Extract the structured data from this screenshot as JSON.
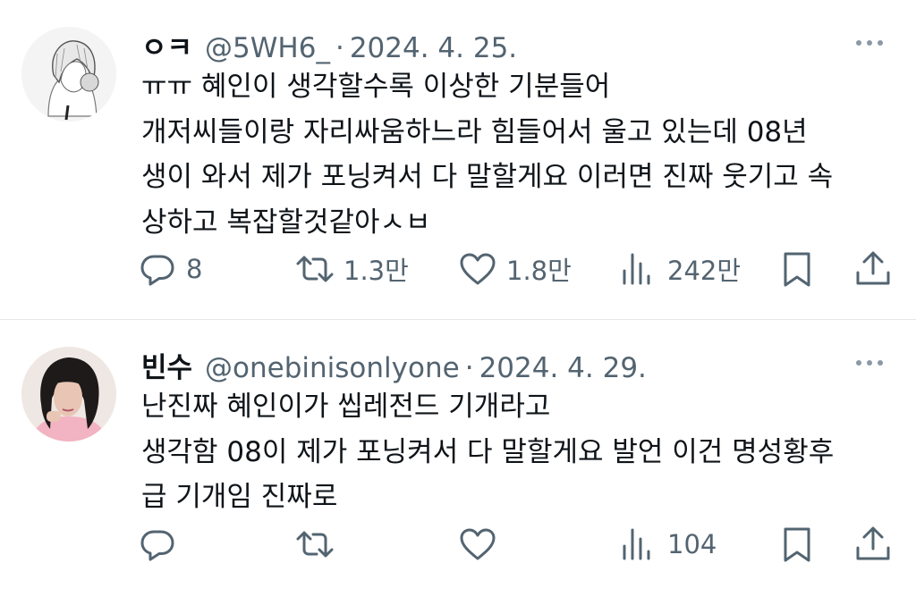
{
  "tweets": [
    {
      "name": "ㅇㅋ",
      "handle": "@5WH6_",
      "separator": "·",
      "date": "2024. 4. 25.",
      "avatar": "sketch-avatar",
      "lines": [
        "ㅠㅠ 혜인이 생각할수록 이상한 기분들어",
        "개저씨들이랑 자리싸움하느라 힘들어서 울고 있는데 08년",
        "생이 와서 제가 포닝켜서 다 말할게요 이러면 진짜 웃기고 속",
        "상하고 복잡할것같아ㅅㅂ"
      ],
      "replies": "8",
      "retweets": "1.3만",
      "likes": "1.8만",
      "views": "242만"
    },
    {
      "name": "빈수",
      "handle": "@onebinisonlyone",
      "separator": "·",
      "date": "2024. 4. 29.",
      "avatar": "photo-avatar",
      "lines": [
        "난진짜 혜인이가 씹레전드 기개라고",
        "생각함 08이 제가 포닝켜서 다 말할게요 발언 이건 명성황후",
        "급 기개임 진짜로"
      ],
      "replies": "",
      "retweets": "",
      "likes": "",
      "views": "104"
    }
  ],
  "icons": {
    "reply": "reply-icon",
    "retweet": "retweet-icon",
    "like": "like-icon",
    "views": "views-icon",
    "bookmark": "bookmark-icon",
    "share": "share-icon",
    "more": "more-icon"
  },
  "colors": {
    "text": "#0f1419",
    "secondary": "#536471",
    "divider": "#e6e6e6"
  }
}
